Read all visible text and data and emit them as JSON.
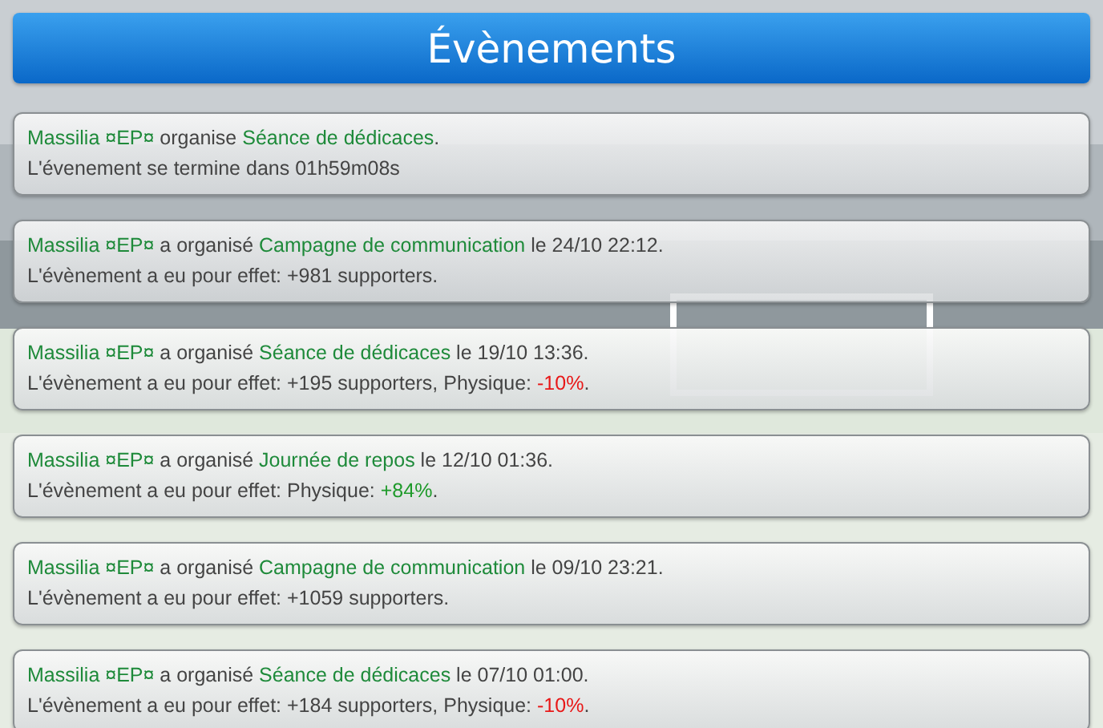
{
  "title": "Évènements",
  "events": [
    {
      "lines": [
        [
          {
            "kind": "highlight",
            "text": "Massilia ¤EP¤"
          },
          {
            "kind": "plain",
            "text": " organise "
          },
          {
            "kind": "highlight",
            "text": "Séance de dédicaces"
          },
          {
            "kind": "plain",
            "text": "."
          }
        ],
        [
          {
            "kind": "plain",
            "text": "L'évenement se termine dans 01h59m08s"
          }
        ]
      ]
    },
    {
      "lines": [
        [
          {
            "kind": "highlight",
            "text": "Massilia ¤EP¤"
          },
          {
            "kind": "plain",
            "text": " a organisé "
          },
          {
            "kind": "highlight",
            "text": "Campagne de communication"
          },
          {
            "kind": "plain",
            "text": " le 24/10 22:12."
          }
        ],
        [
          {
            "kind": "plain",
            "text": "L'évènement a eu pour effet: +981 supporters."
          }
        ]
      ]
    },
    {
      "lines": [
        [
          {
            "kind": "highlight",
            "text": "Massilia ¤EP¤"
          },
          {
            "kind": "plain",
            "text": " a organisé "
          },
          {
            "kind": "highlight",
            "text": "Séance de dédicaces"
          },
          {
            "kind": "plain",
            "text": " le 19/10 13:36."
          }
        ],
        [
          {
            "kind": "plain",
            "text": "L'évènement a eu pour effet: +195 supporters, Physique: "
          },
          {
            "kind": "negative",
            "text": "-10%"
          },
          {
            "kind": "plain",
            "text": "."
          }
        ]
      ]
    },
    {
      "lines": [
        [
          {
            "kind": "highlight",
            "text": "Massilia ¤EP¤"
          },
          {
            "kind": "plain",
            "text": " a organisé "
          },
          {
            "kind": "highlight",
            "text": "Journée de repos"
          },
          {
            "kind": "plain",
            "text": " le 12/10 01:36."
          }
        ],
        [
          {
            "kind": "plain",
            "text": "L'évènement a eu pour effet: Physique: "
          },
          {
            "kind": "positive",
            "text": "+84%"
          },
          {
            "kind": "plain",
            "text": "."
          }
        ]
      ]
    },
    {
      "lines": [
        [
          {
            "kind": "highlight",
            "text": "Massilia ¤EP¤"
          },
          {
            "kind": "plain",
            "text": " a organisé "
          },
          {
            "kind": "highlight",
            "text": "Campagne de communication"
          },
          {
            "kind": "plain",
            "text": " le 09/10 23:21."
          }
        ],
        [
          {
            "kind": "plain",
            "text": "L'évènement a eu pour effet: +1059 supporters."
          }
        ]
      ]
    },
    {
      "lines": [
        [
          {
            "kind": "highlight",
            "text": "Massilia ¤EP¤"
          },
          {
            "kind": "plain",
            "text": " a organisé "
          },
          {
            "kind": "highlight",
            "text": "Séance de dédicaces"
          },
          {
            "kind": "plain",
            "text": " le 07/10 01:00."
          }
        ],
        [
          {
            "kind": "plain",
            "text": "L'évènement a eu pour effet: +184 supporters, Physique: "
          },
          {
            "kind": "negative",
            "text": "-10%"
          },
          {
            "kind": "plain",
            "text": "."
          }
        ]
      ]
    }
  ]
}
